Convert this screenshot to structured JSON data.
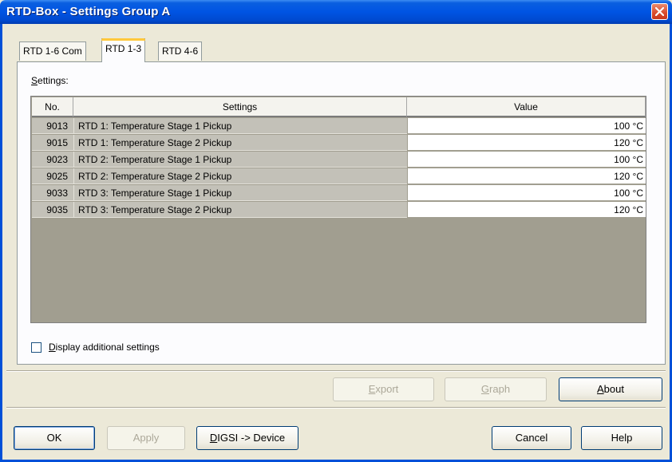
{
  "window": {
    "title": "RTD-Box - Settings Group A"
  },
  "tabs": [
    {
      "label": "RTD 1-6 Com",
      "active": false
    },
    {
      "label": "RTD 1-3",
      "active": true
    },
    {
      "label": "RTD 4-6",
      "active": false
    }
  ],
  "settings_section": {
    "label_hotkey": "S",
    "label_rest": "ettings:"
  },
  "table": {
    "columns": [
      "No.",
      "Settings",
      "Value"
    ],
    "rows": [
      {
        "no": "9013",
        "setting": "RTD 1: Temperature Stage 1 Pickup",
        "value": "100 °C"
      },
      {
        "no": "9015",
        "setting": "RTD 1: Temperature Stage 2 Pickup",
        "value": "120 °C"
      },
      {
        "no": "9023",
        "setting": "RTD 2: Temperature Stage 1 Pickup",
        "value": "100 °C"
      },
      {
        "no": "9025",
        "setting": "RTD 2: Temperature Stage 2 Pickup",
        "value": "120 °C"
      },
      {
        "no": "9033",
        "setting": "RTD 3: Temperature Stage 1 Pickup",
        "value": "100 °C"
      },
      {
        "no": "9035",
        "setting": "RTD 3: Temperature Stage 2 Pickup",
        "value": "120 °C"
      }
    ]
  },
  "additional_settings": {
    "checked": false,
    "label_hotkey": "D",
    "label_rest": "isplay additional settings"
  },
  "action_buttons": {
    "export": {
      "hotkey": "E",
      "rest": "xport",
      "enabled": false
    },
    "graph": {
      "hotkey": "G",
      "rest": "raph",
      "enabled": false
    },
    "about": {
      "hotkey": "A",
      "rest": "bout",
      "enabled": true
    }
  },
  "footer_buttons": {
    "ok": {
      "label": "OK"
    },
    "apply": {
      "label": "Apply",
      "enabled": false
    },
    "digsi": {
      "hotkey": "D",
      "rest": "IGSI -> Device"
    },
    "cancel": {
      "label": "Cancel"
    },
    "help": {
      "label": "Help"
    }
  },
  "colors": {
    "title_bar": "#0054e3",
    "dialog_bg": "#ece9d8",
    "grid_bg": "#a19e90",
    "active_tab_accent": "#ffc83c",
    "close_button": "#d94a2c"
  }
}
